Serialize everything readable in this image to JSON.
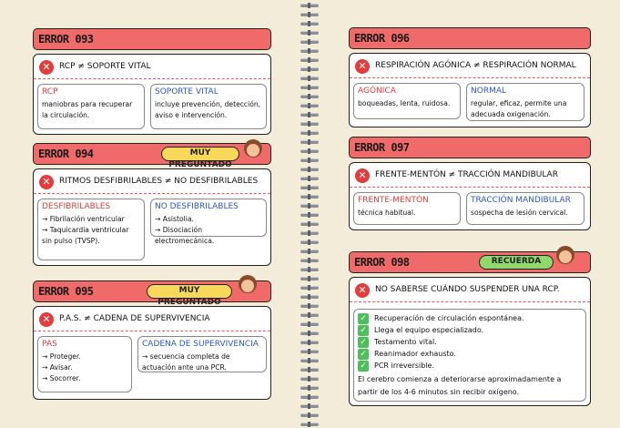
{
  "cards": {
    "e093": {
      "title": "ERROR 093",
      "question": "RCP ≠ SOPORTE VITAL",
      "left_head": "RCP",
      "left_text": "maniobras para recuperar la circulación.",
      "right_head": "SOPORTE VITAL",
      "right_text": "incluye prevención, detección, aviso e intervención."
    },
    "e094": {
      "title": "ERROR 094",
      "badge": "MUY PREGUNTADO",
      "question": "RITMOS DESFIBRILABLES ≠ NO DESFIBRILABLES",
      "left_head": "DESFIBRILABLES",
      "left_items": [
        "→ Fibrilación ventricular",
        "→ Taquicardia ventricular sin pulso (TVSP)."
      ],
      "right_head": "NO DESFIBRILABLES",
      "right_items": [
        "→ Asistolia.",
        "→ Disociación electromecánica."
      ]
    },
    "e095": {
      "title": "ERROR 095",
      "badge": "MUY PREGUNTADO",
      "question": "P.A.S. ≠ CADENA DE SUPERVIVENCIA",
      "left_head": "PAS",
      "left_items": [
        "→ Proteger.",
        "→ Avisar.",
        "→ Socorrer."
      ],
      "right_head": "CADENA DE SUPERVIVENCIA",
      "right_text": "→ secuencia completa de actuación ante una PCR."
    },
    "e096": {
      "title": "ERROR 096",
      "question": "RESPIRACIÓN AGÓNICA ≠ RESPIRACIÓN NORMAL",
      "left_head": "AGÓNICA",
      "left_text": "boqueadas, lenta, ruidosa.",
      "right_head": "NORMAL",
      "right_text": "regular, eficaz, permite una adecuada oxigenación."
    },
    "e097": {
      "title": "ERROR 097",
      "question": "FRENTE-MENTÓN ≠ TRACCIÓN MANDIBULAR",
      "left_head": "FRENTE-MENTÓN",
      "left_text": "técnica habitual.",
      "right_head": "TRACCIÓN MANDIBULAR",
      "right_text": "sospecha de lesión cervical."
    },
    "e098": {
      "title": "ERROR 098",
      "badge": "RECUERDA",
      "question": "NO SABERSE CUÁNDO SUSPENDER UNA RCP.",
      "checks": [
        "Recuperación de circulación espontánea.",
        "Llega el equipo especializado.",
        "Testamento vital.",
        "Reanimador exhausto.",
        "PCR irreversible."
      ],
      "note": "El cerebro comienza a deteriorarse aproximadamente a partir de los 4-6 minutos sin recibir oxígeno."
    }
  },
  "icons": {
    "x": "✕",
    "check": "✓"
  },
  "colors": {
    "header": "#f06a6a",
    "badge_yellow": "#f7d85a",
    "badge_green": "#8fd96a",
    "accent_red": "#e53b3b",
    "accent_blue": "#2d55c8",
    "check_green": "#4fbf5a"
  }
}
